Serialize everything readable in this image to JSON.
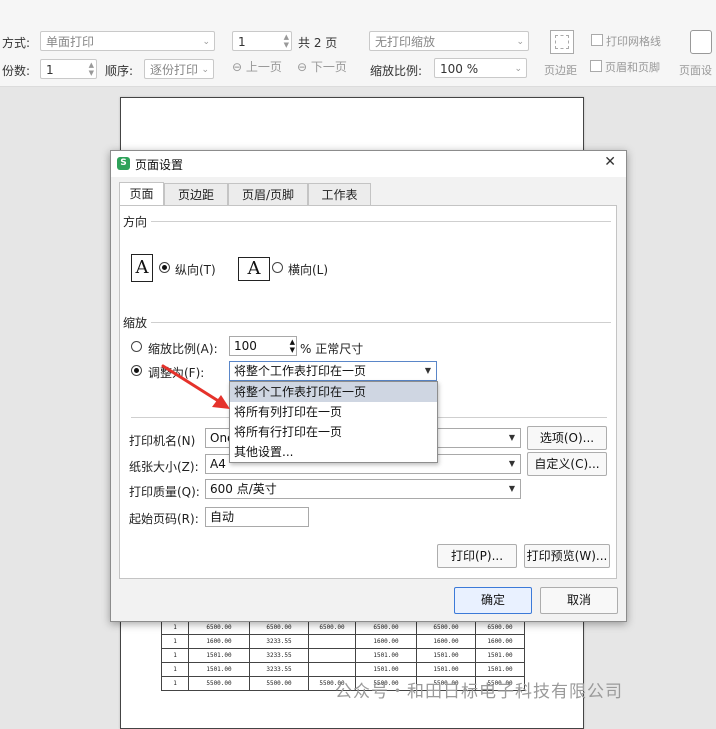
{
  "toolbar": {
    "mode_label": "方式:",
    "mode_value": "单面打印",
    "copies_label": "份数:",
    "copies_value": "1",
    "order_label": "顺序:",
    "order_value": "逐份打印",
    "page_value": "1",
    "total_pages": "共 2 页",
    "prev_page": "上一页",
    "next_page": "下一页",
    "scale_select": "无打印缩放",
    "zoom_label": "缩放比例:",
    "zoom_value": "100 %",
    "margin_btn": "页边距",
    "gridlines_label": "打印网格线",
    "header_footer_btn": "页眉和页脚",
    "page_setup_btn": "页面设"
  },
  "preview": {
    "rows": [
      [
        "1",
        "6500.00",
        "6500.00",
        "6500.00",
        "6500.00",
        "6500.00",
        "6500.00"
      ],
      [
        "1",
        "1600.00",
        "3233.55",
        "",
        "1600.00",
        "1600.00",
        "1600.00"
      ],
      [
        "1",
        "1501.00",
        "3233.55",
        "",
        "1501.00",
        "1501.00",
        "1501.00"
      ],
      [
        "1",
        "1501.00",
        "3233.55",
        "",
        "1501.00",
        "1501.00",
        "1501.00"
      ],
      [
        "1",
        "5500.00",
        "5500.00",
        "5500.00",
        "5500.00",
        "5500.00",
        "5500.00"
      ]
    ],
    "watermark": "公众号・和田日标电子科技有限公司"
  },
  "dialog": {
    "title": "页面设置",
    "logo_letter": "S",
    "close": "✕",
    "tabs": [
      "页面",
      "页边距",
      "页眉/页脚",
      "工作表"
    ],
    "orientation_label": "方向",
    "portrait": "纵向(T)",
    "landscape": "横向(L)",
    "orient_glyph": "A",
    "scaling_label": "缩放",
    "scale_ratio_label": "缩放比例(A):",
    "scale_ratio_value": "100",
    "normal_size": "% 正常尺寸",
    "fit_label": "调整为(F):",
    "fit_value": "将整个工作表打印在一页",
    "fit_options": [
      "将整个工作表打印在一页",
      "将所有列打印在一页",
      "将所有行打印在一页",
      "其他设置..."
    ],
    "printer_label": "打印机名(N)",
    "printer_value": "One",
    "options_btn": "选项(O)...",
    "paper_label": "纸张大小(Z):",
    "paper_value": "A4",
    "custom_btn": "自定义(C)...",
    "quality_label": "打印质量(Q):",
    "quality_value": "600 点/英寸",
    "first_page_label": "起始页码(R):",
    "first_page_value": "自动",
    "print_btn": "打印(P)...",
    "preview_btn": "打印预览(W)...",
    "ok_btn": "确定",
    "cancel_btn": "取消"
  },
  "colors": {
    "annotation_arrow": "#e5322b",
    "app_logo": "#2ea25a",
    "dropdown_highlight": "#cfd6e2"
  }
}
